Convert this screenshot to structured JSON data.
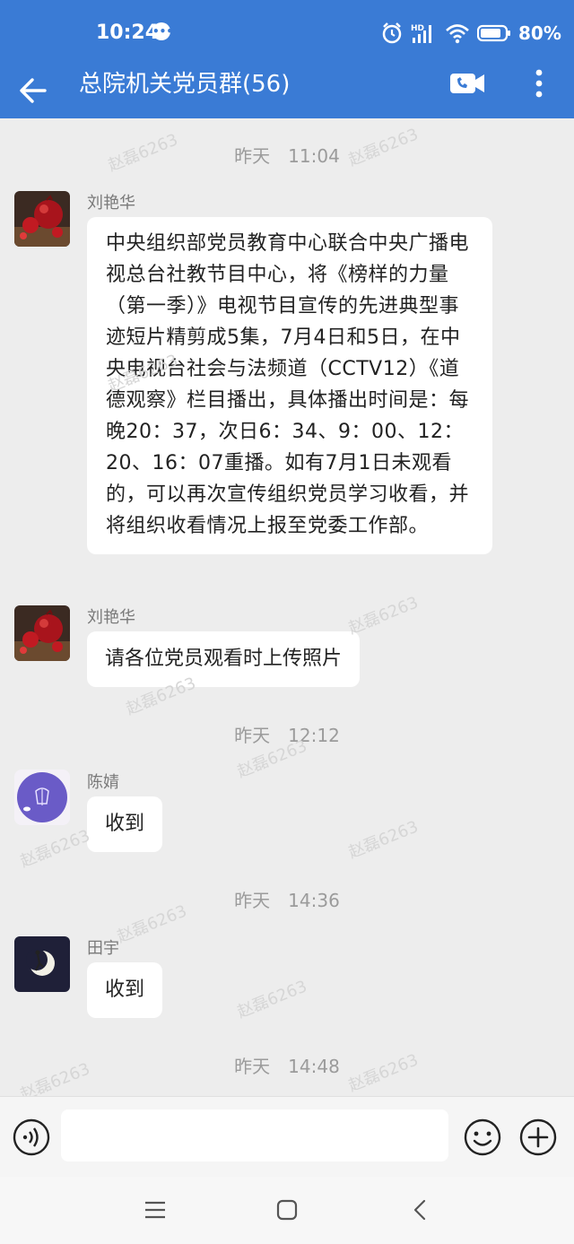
{
  "status_bar": {
    "time": "10:24",
    "notification_badge": "•••",
    "network_label": "HD",
    "battery": "80%"
  },
  "header": {
    "title": "总院机关党员群(56)",
    "accent_color": "#3a7bd5"
  },
  "messages": [
    {
      "type": "timestamp",
      "text": "昨天　11:04"
    },
    {
      "type": "message",
      "sender": "刘艳华",
      "avatar": "pomegranate-avatar",
      "text": "中央组织部党员教育中心联合中央广播电视总台社教节目中心，将《榜样的力量（第一季）》电视节目宣传的先进典型事迹短片精剪成5集，7月4日和5日，在中央电视台社会与法频道（CCTV12）《道德观察》栏目播出，具体播出时间是：每晚20：37，次日6：34、9：00、12：20、16：07重播。如有7月1日未观看的，可以再次宣传组织党员学习收看，并将组织收看情况上报至党委工作部。"
    },
    {
      "type": "message",
      "sender": "刘艳华",
      "avatar": "pomegranate-avatar",
      "text": "请各位党员观看时上传照片"
    },
    {
      "type": "timestamp",
      "text": "昨天　12:12"
    },
    {
      "type": "message",
      "sender": "陈婧",
      "avatar": "purple-circle-avatar",
      "text": "收到"
    },
    {
      "type": "timestamp",
      "text": "昨天　14:36"
    },
    {
      "type": "message",
      "sender": "田宇",
      "avatar": "moon-avatar",
      "text": "收到"
    },
    {
      "type": "timestamp",
      "text": "昨天　14:48"
    }
  ],
  "watermark": "赵磊6263",
  "input": {
    "placeholder": "",
    "value": ""
  },
  "icons": {
    "back": "back-arrow-icon",
    "video": "video-call-icon",
    "more": "more-vertical-icon",
    "voice": "voice-icon",
    "emoji": "emoji-icon",
    "plus": "plus-icon",
    "nav_menu": "menu-icon",
    "nav_home": "home-icon",
    "nav_back": "back-icon"
  }
}
